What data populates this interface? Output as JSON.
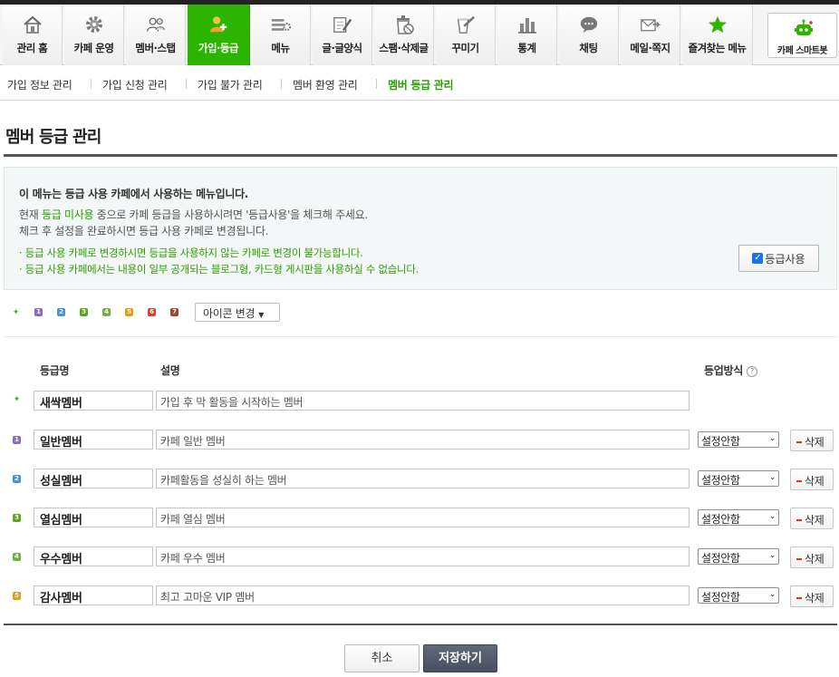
{
  "topnav": {
    "tabs": [
      {
        "label": "관리 홈",
        "icon": "home-icon"
      },
      {
        "label": "카페 운영",
        "icon": "gear-icon"
      },
      {
        "label": "멤버·스탭",
        "icon": "members-icon"
      },
      {
        "label": "가입·등급",
        "icon": "join-level-icon",
        "active": true
      },
      {
        "label": "메뉴",
        "icon": "menu-icon"
      },
      {
        "label": "글·글양식",
        "icon": "pencil-icon"
      },
      {
        "label": "스팸·삭제글",
        "icon": "trash-icon"
      },
      {
        "label": "꾸미기",
        "icon": "decorate-icon"
      },
      {
        "label": "통계",
        "icon": "chart-icon"
      },
      {
        "label": "채팅",
        "icon": "chat-icon"
      },
      {
        "label": "메일·쪽지",
        "icon": "mail-icon"
      },
      {
        "label": "즐겨찾는 메뉴",
        "icon": "star-icon"
      }
    ],
    "smartbot_label": "카페 스마트봇"
  },
  "subnav": {
    "items": [
      {
        "label": "가입 정보 관리"
      },
      {
        "label": "가입 신청 관리"
      },
      {
        "label": "가입 불가 관리"
      },
      {
        "label": "멤버 환영 관리"
      },
      {
        "label": "멤버 등급 관리",
        "active": true
      }
    ]
  },
  "page": {
    "title": "멤버 등급 관리"
  },
  "notice": {
    "title": "이 메뉴는 등급 사용 카페에서 사용하는 메뉴입니다.",
    "line1_pre": "현재 ",
    "line1_highlight": "등급 미사용",
    "line1_post": " 중으로 카페 등급을 사용하시려면 '등급사용'을 체크해 주세요.",
    "line2": "체크 후 설정을 완료하시면 등급 사용 카페로 변경됩니다.",
    "warn1": "· 등급 사용 카페로 변경하시면 등급을 사용하지 않는 카페로 변경이 불가능합니다.",
    "warn2": "· 등급 사용 카페에서는 내용이 일부 공개되는 블로그형, 카드형 게시판을 사용하실 수 없습니다.",
    "use_label": "등급사용",
    "use_checked": true
  },
  "icons": {
    "change_label": "아이콘 변경",
    "set": [
      {
        "glyph": "✦",
        "color": "#5aa820"
      },
      {
        "glyph": "1",
        "color": "#8c6cc4"
      },
      {
        "glyph": "2",
        "color": "#4a8fd6"
      },
      {
        "glyph": "3",
        "color": "#5aa820"
      },
      {
        "glyph": "4",
        "color": "#6cb33f"
      },
      {
        "glyph": "5",
        "color": "#d8a31a"
      },
      {
        "glyph": "6",
        "color": "#d8412f"
      },
      {
        "glyph": "7",
        "color": "#a1452a"
      }
    ]
  },
  "table": {
    "header_name": "등급명",
    "header_desc": "설명",
    "header_method": "등업방식",
    "help_glyph": "?",
    "rows": [
      {
        "name": "새싹멤버",
        "desc": "가입 후 막 활동을 시작하는 멤버",
        "icon_glyph": "✦",
        "icon_color": "#5aa820"
      },
      {
        "name": "일반멤버",
        "desc": "카페 일반 멤버",
        "method": "설정안함",
        "delete": "삭제",
        "icon_glyph": "1",
        "icon_color": "#8c6cc4"
      },
      {
        "name": "성실멤버",
        "desc": "카페활동을 성실히 하는 멤버",
        "method": "설정안함",
        "delete": "삭제",
        "icon_glyph": "2",
        "icon_color": "#4a8fd6"
      },
      {
        "name": "열심멤버",
        "desc": "카페 열심 멤버",
        "method": "설정안함",
        "delete": "삭제",
        "icon_glyph": "3",
        "icon_color": "#5aa820"
      },
      {
        "name": "우수멤버",
        "desc": "카페 우수 멤버",
        "method": "설정안함",
        "delete": "삭제",
        "icon_glyph": "4",
        "icon_color": "#6cb33f"
      },
      {
        "name": "감사멤버",
        "desc": "최고 고마운 VIP 멤버",
        "method": "설정안함",
        "delete": "삭제",
        "icon_glyph": "5",
        "icon_color": "#d8a31a"
      }
    ]
  },
  "actions": {
    "cancel_label": "취소",
    "save_label": "저장하기"
  },
  "colors": {
    "accent": "#2db400",
    "accent_text": "#26a000",
    "save_button": "#49505f"
  }
}
